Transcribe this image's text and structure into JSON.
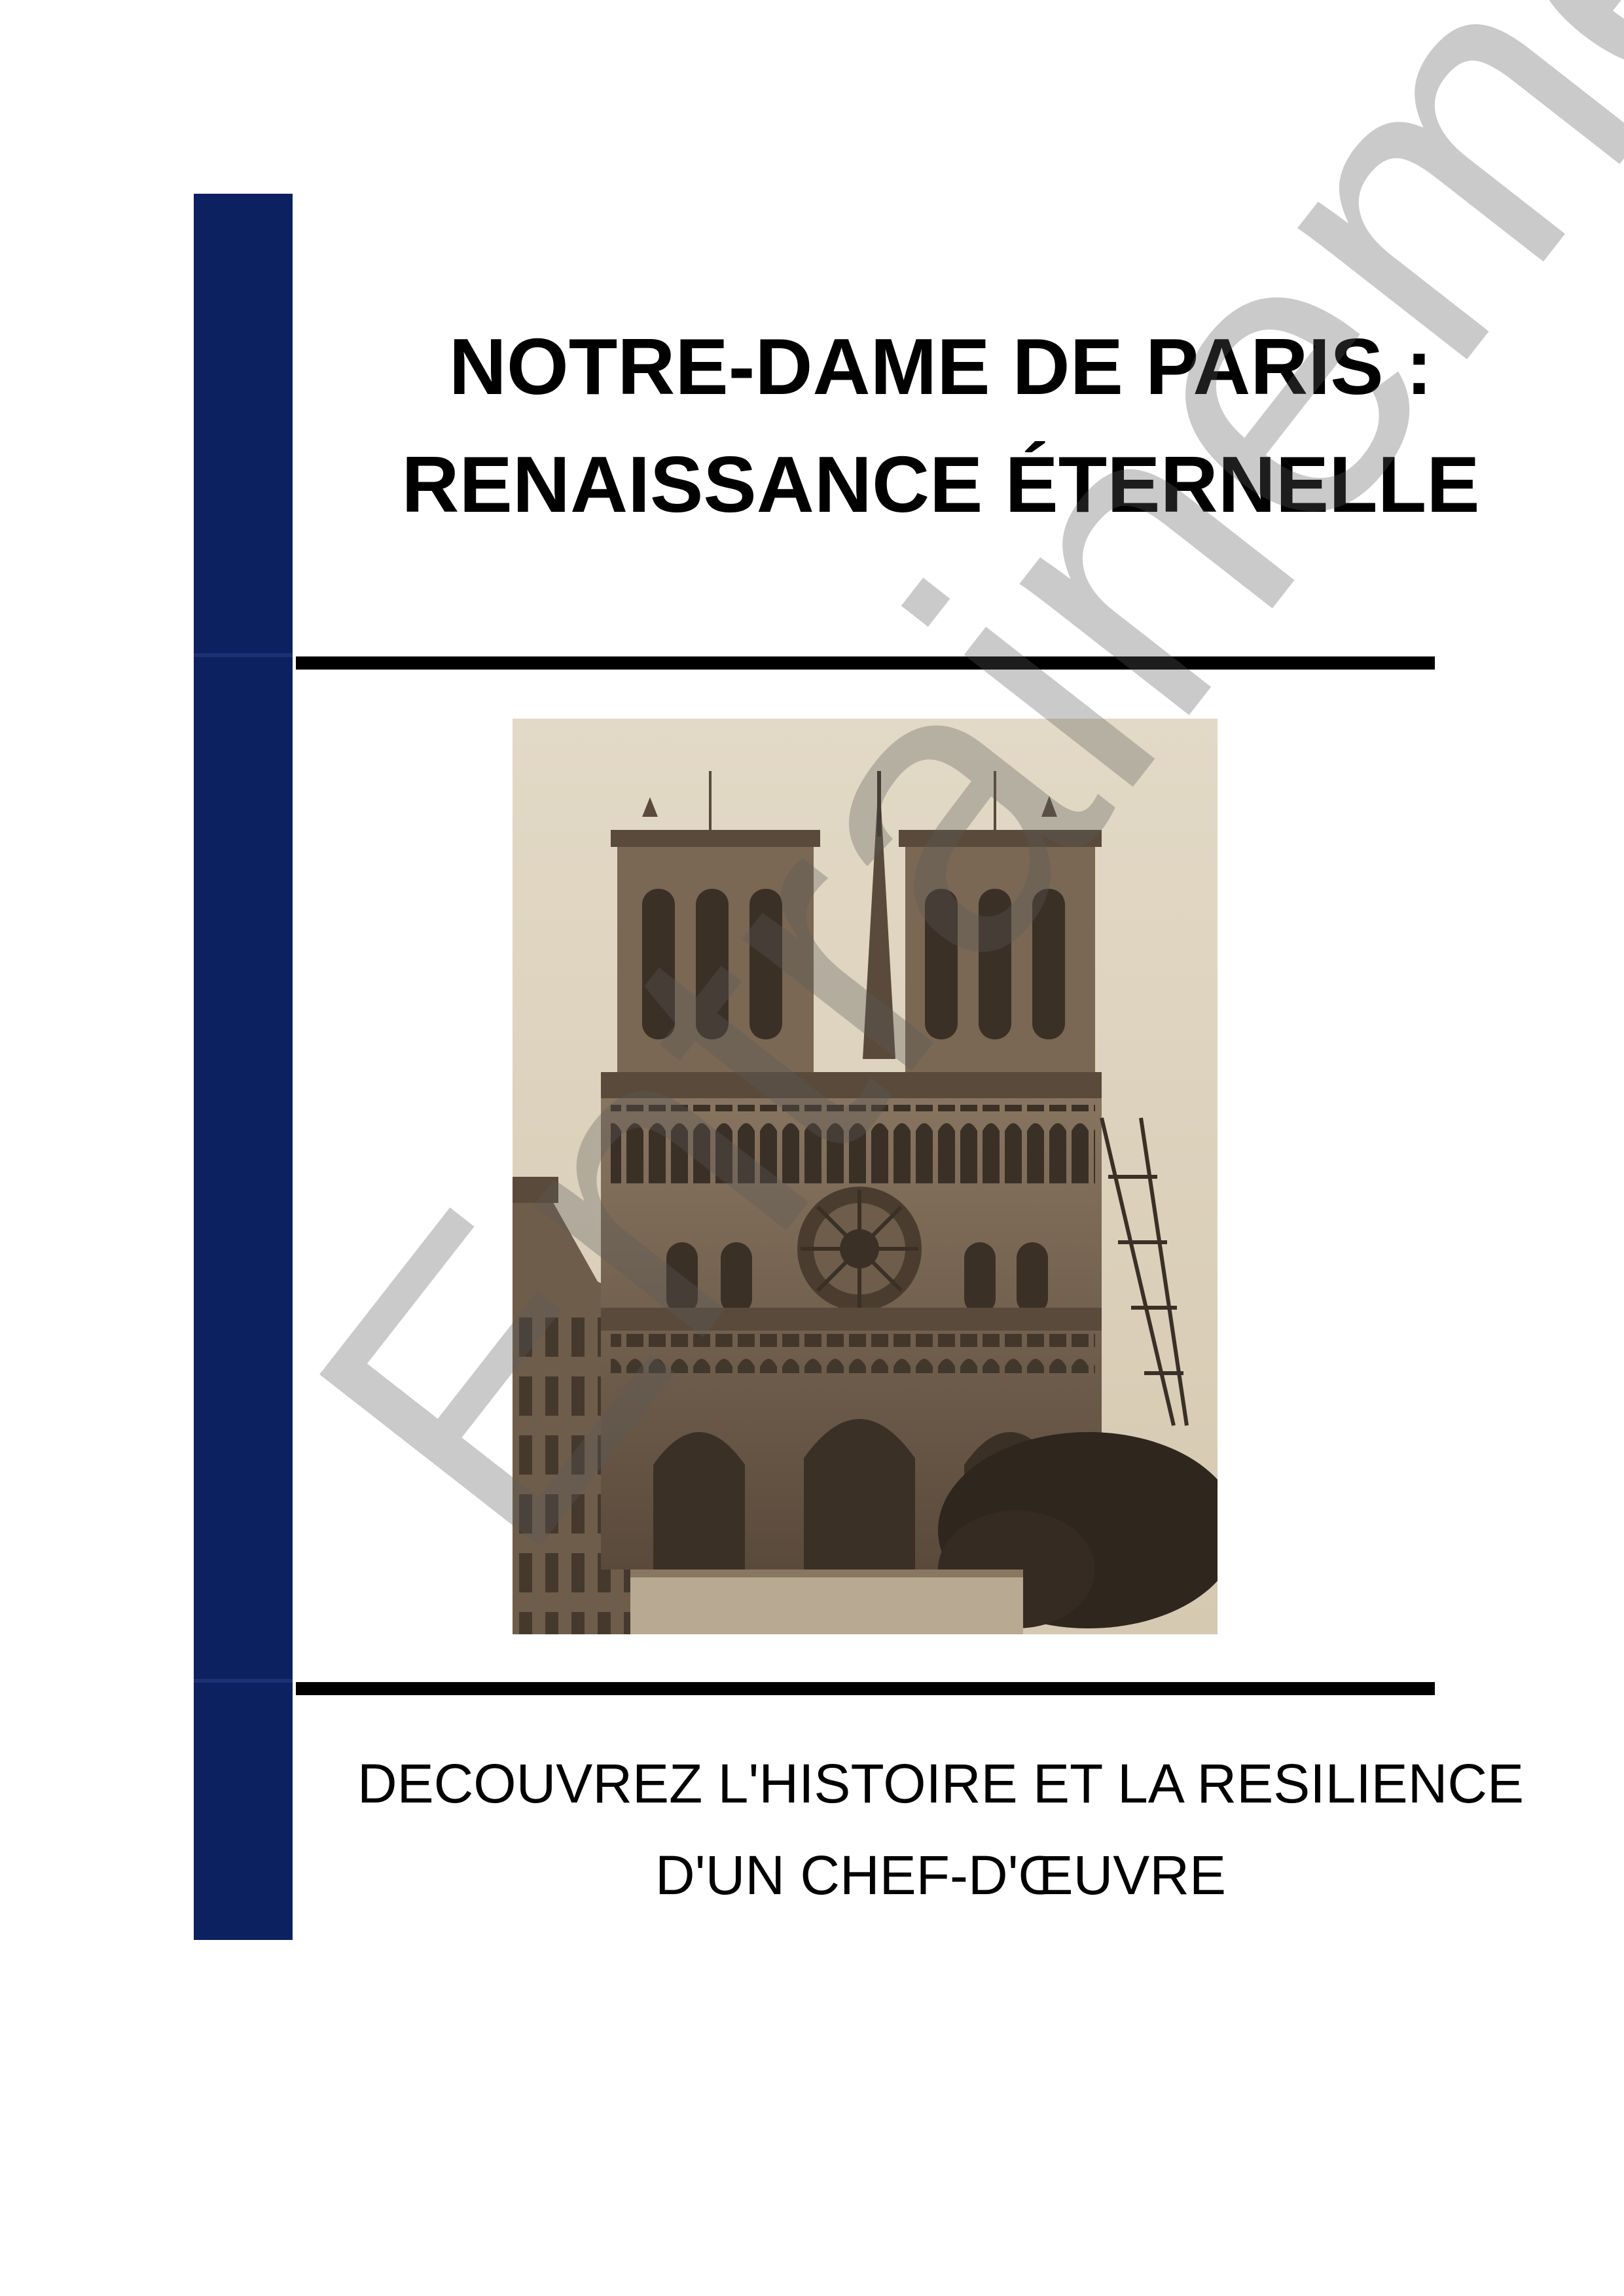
{
  "document": {
    "title_line_1": "NOTRE-DAME DE PARIS :",
    "title_line_2": "RENAISSANCE ÉTERNELLE",
    "subtitle_line_1": "DECOUVREZ L'HISTOIRE ET LA RESILIENCE",
    "subtitle_line_2": "D'UN CHEF-D'ŒUVRE",
    "watermark_text": "Entrainement"
  },
  "photo": {
    "subject": "Notre-Dame de Paris west facade",
    "tone": "sepia"
  },
  "colors": {
    "sidebar": "#0c2160",
    "rules": "#000000",
    "text": "#000000",
    "photo_paper": "#ddd3c0",
    "photo_stone": "#6e5d4b",
    "photo_dark": "#3b3026"
  }
}
